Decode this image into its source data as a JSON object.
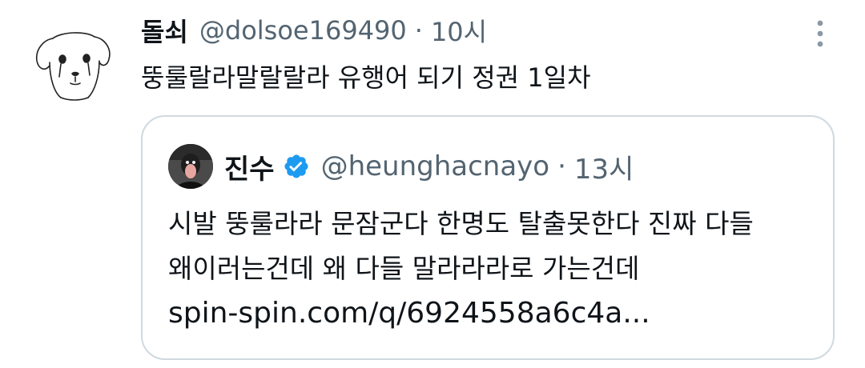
{
  "tweet": {
    "display_name": "돌쇠",
    "handle": "@dolsoe169490",
    "separator": "·",
    "time": "10시",
    "text": "뚱룰랄라말랄랄라 유행어 되기 정권 1일차",
    "avatar_icon": "sketch-dog-face-icon",
    "more_icon": "more-vertical-dots-icon"
  },
  "quote": {
    "display_name": "진수",
    "verified_icon": "verified-badge-icon",
    "verified_color": "#1d9bf0",
    "handle": "@heunghacnayo",
    "separator": "·",
    "time": "13시",
    "lines": [
      "시발 뚱룰라라 문잠군다 한명도 탈출못한다 진짜 다들",
      "왜이러는건데 왜 다들 말라라라로 가는건데",
      "spin-spin.com/q/6924558a6c4a..."
    ]
  },
  "colors": {
    "text_primary": "#0f1419",
    "text_secondary": "#536471",
    "border": "#cfd9de",
    "accent": "#1d9bf0"
  }
}
